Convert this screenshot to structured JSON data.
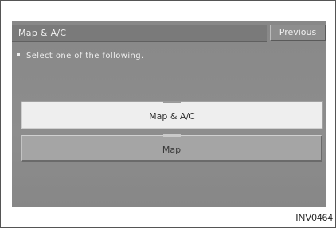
{
  "screen": {
    "title": "Map & A/C",
    "previous_label": "Previous",
    "instruction": "Select one of the following.",
    "options": [
      {
        "label": "Map & A/C",
        "state": "selected"
      },
      {
        "label": "Map",
        "state": "normal"
      }
    ]
  },
  "caption": "INV0464"
}
